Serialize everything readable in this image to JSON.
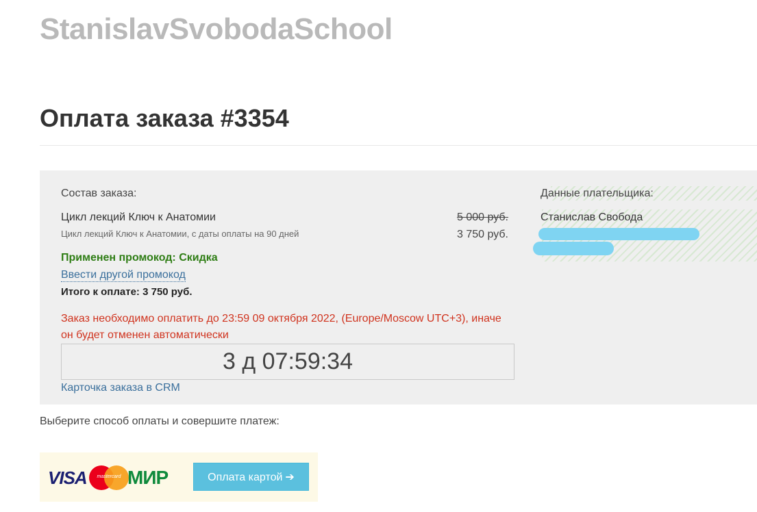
{
  "header": {
    "school_name": "StanislavSvobodaSchool",
    "order_title": "Оплата заказа #3354"
  },
  "order": {
    "label": "Состав заказа:",
    "item_name": "Цикл лекций Ключ к Анатомии",
    "item_description": "Цикл лекций Ключ к Анатомии, с даты оплаты на 90 дней",
    "price_old": "5 000 руб.",
    "price_new": "3 750 руб.",
    "promo_applied": "Применен промокод: Скидка",
    "promo_link": "Ввести другой промокод",
    "total": "Итого к оплате: 3 750 руб.",
    "warning": "Заказ необходимо оплатить до 23:59 09 октября 2022, (Europe/Moscow UTC+3), иначе он будет отменен автоматически",
    "timer": "3 д 07:59:34",
    "crm_link": "Карточка заказа в CRM"
  },
  "payer": {
    "label": "Данные плательщика:",
    "name": "Станислав Свобода"
  },
  "payment": {
    "choose_label": "Выберите способ оплаты и совершите платеж:",
    "visa_text": "VISA",
    "mastercard_text": "mastercard",
    "mir_text": "МИР",
    "pay_button_label": "Оплата картой",
    "pay_button_icon": "arrow-right-icon"
  },
  "colors": {
    "promo_green": "#2e7d14",
    "warning_red": "#d0331e",
    "link_blue": "#3a6f9c",
    "button_blue": "#5bc0de",
    "panel_gray": "#efefef"
  }
}
